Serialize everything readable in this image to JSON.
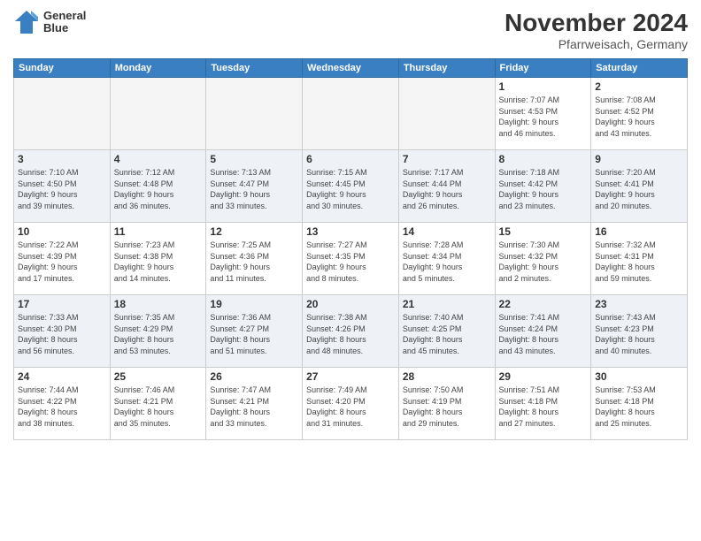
{
  "header": {
    "logo_line1": "General",
    "logo_line2": "Blue",
    "month": "November 2024",
    "location": "Pfarrweisach, Germany"
  },
  "weekdays": [
    "Sunday",
    "Monday",
    "Tuesday",
    "Wednesday",
    "Thursday",
    "Friday",
    "Saturday"
  ],
  "weeks": [
    [
      {
        "day": "",
        "info": ""
      },
      {
        "day": "",
        "info": ""
      },
      {
        "day": "",
        "info": ""
      },
      {
        "day": "",
        "info": ""
      },
      {
        "day": "",
        "info": ""
      },
      {
        "day": "1",
        "info": "Sunrise: 7:07 AM\nSunset: 4:53 PM\nDaylight: 9 hours\nand 46 minutes."
      },
      {
        "day": "2",
        "info": "Sunrise: 7:08 AM\nSunset: 4:52 PM\nDaylight: 9 hours\nand 43 minutes."
      }
    ],
    [
      {
        "day": "3",
        "info": "Sunrise: 7:10 AM\nSunset: 4:50 PM\nDaylight: 9 hours\nand 39 minutes."
      },
      {
        "day": "4",
        "info": "Sunrise: 7:12 AM\nSunset: 4:48 PM\nDaylight: 9 hours\nand 36 minutes."
      },
      {
        "day": "5",
        "info": "Sunrise: 7:13 AM\nSunset: 4:47 PM\nDaylight: 9 hours\nand 33 minutes."
      },
      {
        "day": "6",
        "info": "Sunrise: 7:15 AM\nSunset: 4:45 PM\nDaylight: 9 hours\nand 30 minutes."
      },
      {
        "day": "7",
        "info": "Sunrise: 7:17 AM\nSunset: 4:44 PM\nDaylight: 9 hours\nand 26 minutes."
      },
      {
        "day": "8",
        "info": "Sunrise: 7:18 AM\nSunset: 4:42 PM\nDaylight: 9 hours\nand 23 minutes."
      },
      {
        "day": "9",
        "info": "Sunrise: 7:20 AM\nSunset: 4:41 PM\nDaylight: 9 hours\nand 20 minutes."
      }
    ],
    [
      {
        "day": "10",
        "info": "Sunrise: 7:22 AM\nSunset: 4:39 PM\nDaylight: 9 hours\nand 17 minutes."
      },
      {
        "day": "11",
        "info": "Sunrise: 7:23 AM\nSunset: 4:38 PM\nDaylight: 9 hours\nand 14 minutes."
      },
      {
        "day": "12",
        "info": "Sunrise: 7:25 AM\nSunset: 4:36 PM\nDaylight: 9 hours\nand 11 minutes."
      },
      {
        "day": "13",
        "info": "Sunrise: 7:27 AM\nSunset: 4:35 PM\nDaylight: 9 hours\nand 8 minutes."
      },
      {
        "day": "14",
        "info": "Sunrise: 7:28 AM\nSunset: 4:34 PM\nDaylight: 9 hours\nand 5 minutes."
      },
      {
        "day": "15",
        "info": "Sunrise: 7:30 AM\nSunset: 4:32 PM\nDaylight: 9 hours\nand 2 minutes."
      },
      {
        "day": "16",
        "info": "Sunrise: 7:32 AM\nSunset: 4:31 PM\nDaylight: 8 hours\nand 59 minutes."
      }
    ],
    [
      {
        "day": "17",
        "info": "Sunrise: 7:33 AM\nSunset: 4:30 PM\nDaylight: 8 hours\nand 56 minutes."
      },
      {
        "day": "18",
        "info": "Sunrise: 7:35 AM\nSunset: 4:29 PM\nDaylight: 8 hours\nand 53 minutes."
      },
      {
        "day": "19",
        "info": "Sunrise: 7:36 AM\nSunset: 4:27 PM\nDaylight: 8 hours\nand 51 minutes."
      },
      {
        "day": "20",
        "info": "Sunrise: 7:38 AM\nSunset: 4:26 PM\nDaylight: 8 hours\nand 48 minutes."
      },
      {
        "day": "21",
        "info": "Sunrise: 7:40 AM\nSunset: 4:25 PM\nDaylight: 8 hours\nand 45 minutes."
      },
      {
        "day": "22",
        "info": "Sunrise: 7:41 AM\nSunset: 4:24 PM\nDaylight: 8 hours\nand 43 minutes."
      },
      {
        "day": "23",
        "info": "Sunrise: 7:43 AM\nSunset: 4:23 PM\nDaylight: 8 hours\nand 40 minutes."
      }
    ],
    [
      {
        "day": "24",
        "info": "Sunrise: 7:44 AM\nSunset: 4:22 PM\nDaylight: 8 hours\nand 38 minutes."
      },
      {
        "day": "25",
        "info": "Sunrise: 7:46 AM\nSunset: 4:21 PM\nDaylight: 8 hours\nand 35 minutes."
      },
      {
        "day": "26",
        "info": "Sunrise: 7:47 AM\nSunset: 4:21 PM\nDaylight: 8 hours\nand 33 minutes."
      },
      {
        "day": "27",
        "info": "Sunrise: 7:49 AM\nSunset: 4:20 PM\nDaylight: 8 hours\nand 31 minutes."
      },
      {
        "day": "28",
        "info": "Sunrise: 7:50 AM\nSunset: 4:19 PM\nDaylight: 8 hours\nand 29 minutes."
      },
      {
        "day": "29",
        "info": "Sunrise: 7:51 AM\nSunset: 4:18 PM\nDaylight: 8 hours\nand 27 minutes."
      },
      {
        "day": "30",
        "info": "Sunrise: 7:53 AM\nSunset: 4:18 PM\nDaylight: 8 hours\nand 25 minutes."
      }
    ]
  ]
}
